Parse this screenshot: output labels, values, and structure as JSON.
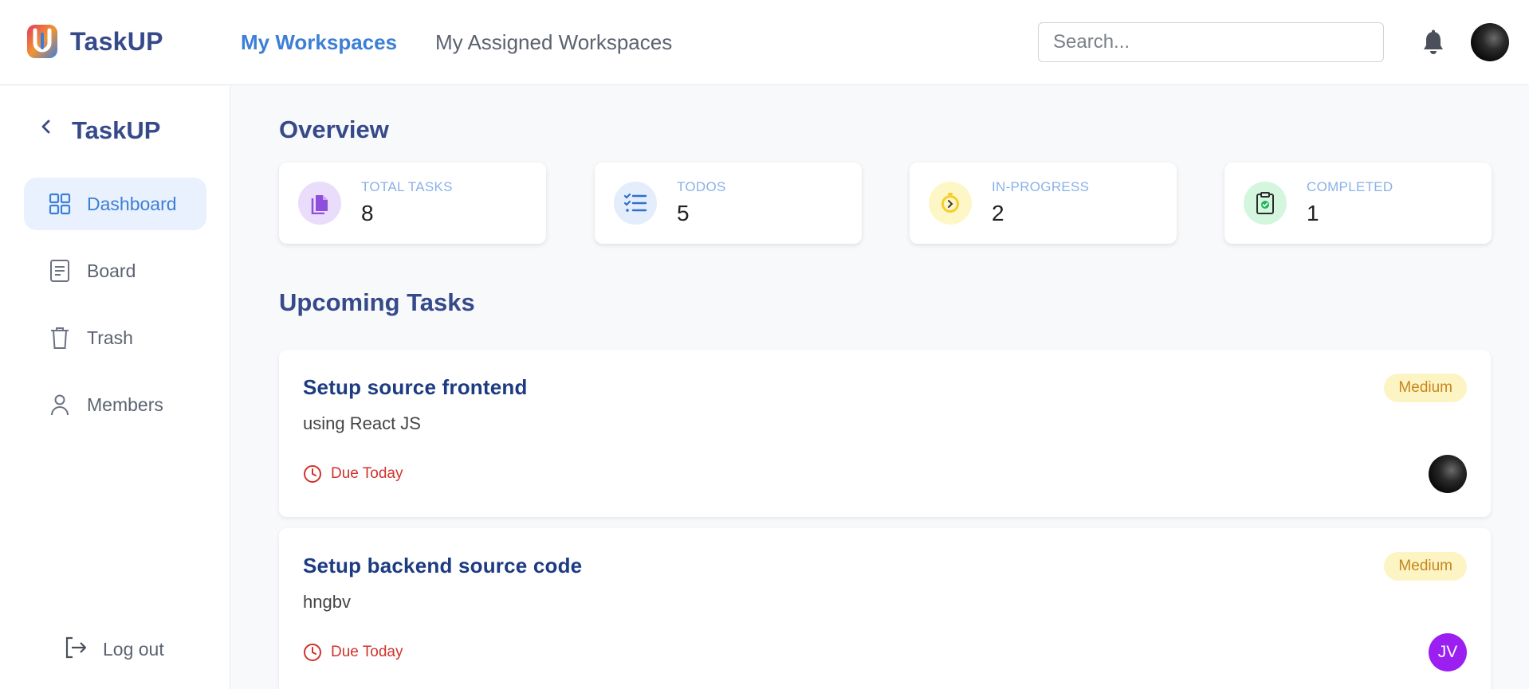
{
  "app": {
    "name": "TaskUP"
  },
  "nav": {
    "my_workspaces": "My Workspaces",
    "my_assigned_workspaces": "My Assigned Workspaces"
  },
  "search": {
    "placeholder": "Search...",
    "value": ""
  },
  "icons": {
    "notifications": "bell-icon",
    "back": "chevron-left-icon",
    "dashboard": "grid-icon",
    "board": "document-icon",
    "trash": "trash-icon",
    "members": "user-icon",
    "logout": "logout-icon",
    "total_tasks": "files-icon",
    "todos": "checklist-icon",
    "in_progress": "timer-icon",
    "completed": "clipboard-check-icon",
    "due": "clock-icon"
  },
  "sidebar": {
    "title": "TaskUP",
    "items": [
      {
        "label": "Dashboard",
        "active": true
      },
      {
        "label": "Board",
        "active": false
      },
      {
        "label": "Trash",
        "active": false
      },
      {
        "label": "Members",
        "active": false
      }
    ],
    "logout_label": "Log out"
  },
  "overview": {
    "title": "Overview",
    "stats": [
      {
        "label": "TOTAL TASKS",
        "value": "8",
        "color": "#e9ddfb"
      },
      {
        "label": "TODOS",
        "value": "5",
        "color": "#e3edfc"
      },
      {
        "label": "IN-PROGRESS",
        "value": "2",
        "color": "#fdf7c8"
      },
      {
        "label": "COMPLETED",
        "value": "1",
        "color": "#d4f6df"
      }
    ]
  },
  "upcoming": {
    "title": "Upcoming Tasks",
    "tasks": [
      {
        "title": "Setup source frontend",
        "description": "using React JS",
        "priority": "Medium",
        "due": "Due Today",
        "assignee_initials": ""
      },
      {
        "title": "Setup backend source code",
        "description": "hngbv",
        "priority": "Medium",
        "due": "Due Today",
        "assignee_initials": "JV"
      }
    ]
  },
  "colors": {
    "brand": "#364a8a",
    "accent": "#3d7fd6",
    "due": "#d1322c",
    "badge_bg": "#fdf4c4",
    "badge_text": "#c7861c",
    "assignee_jv": "#9b1ff0"
  }
}
